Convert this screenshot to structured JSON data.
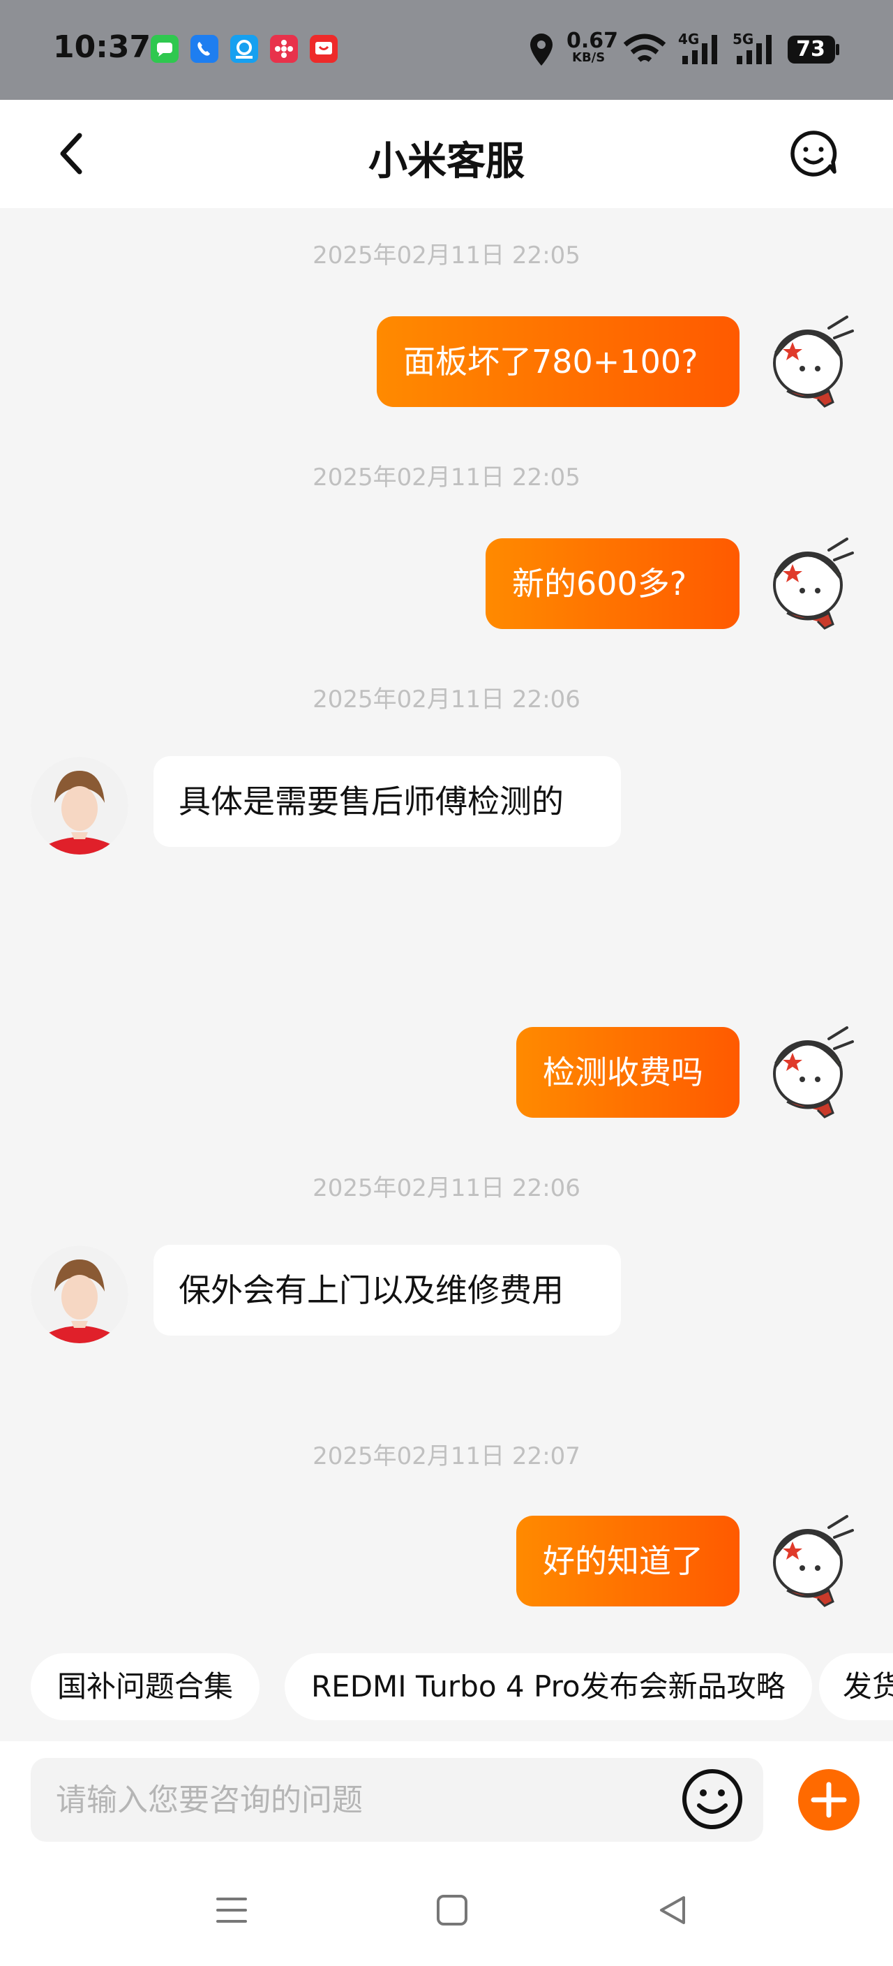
{
  "status_bar": {
    "time": "10:37",
    "network_speed": "0.67",
    "network_unit": "KB/S",
    "signal_1": "4G",
    "signal_2": "5G",
    "battery": "73",
    "icons": [
      "messages-app-icon",
      "phone-app-icon",
      "browser-app-icon",
      "flower-app-icon",
      "shopping-app-icon",
      "location-icon",
      "wifi-icon",
      "signal-icon",
      "battery-icon"
    ]
  },
  "header": {
    "title": "小米客服",
    "back_icon": "back-icon",
    "service_icon": "chat-smile-icon"
  },
  "messages": [
    {
      "time": "2025年02月11日 22:05",
      "from": "user",
      "text": "面板坏了780+100?"
    },
    {
      "time": "2025年02月11日 22:05",
      "from": "user",
      "text": "新的600多?"
    },
    {
      "time": "2025年02月11日 22:06",
      "from": "agent",
      "text": "具体是需要售后师傅检测的"
    },
    {
      "time": "",
      "from": "user",
      "text": "检测收费吗"
    },
    {
      "time": "2025年02月11日 22:06",
      "from": "agent",
      "text": "保外会有上门以及维修费用"
    },
    {
      "time": "2025年02月11日 22:07",
      "from": "user",
      "text": "好的知道了"
    }
  ],
  "quick_replies": [
    "国补问题合集",
    "REDMI Turbo 4 Pro发布会新品攻略",
    "发货"
  ],
  "input": {
    "placeholder": "请输入您要咨询的问题",
    "value": "",
    "emoji_icon": "emoji-icon",
    "add_icon": "plus-icon"
  },
  "colors": {
    "accent": "#ff6a00",
    "status_bar_bg": "#8e9095",
    "page_bg": "#f5f5f5",
    "timestamp": "#c0c0c0"
  },
  "nav": {
    "icons": [
      "menu-icon",
      "home-icon",
      "back-nav-icon"
    ]
  }
}
